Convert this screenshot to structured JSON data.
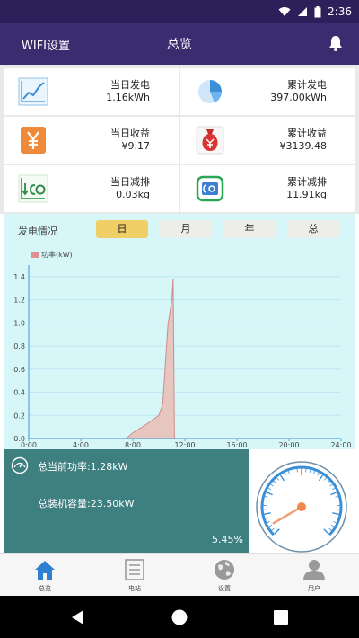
{
  "status_bar": {
    "time": "2:36"
  },
  "app_bar": {
    "left_label": "WIFI设置",
    "title": "总览",
    "bell_icon": "bell-icon"
  },
  "stats": [
    {
      "icon": "line-chart-icon",
      "label": "当日发电",
      "value": "1.16kWh"
    },
    {
      "icon": "pie-chart-icon",
      "label": "累计发电",
      "value": "397.00kWh"
    },
    {
      "icon": "yuan-icon",
      "label": "当日收益",
      "value": "¥9.17"
    },
    {
      "icon": "money-bag-icon",
      "label": "累计收益",
      "value": "¥3139.48"
    },
    {
      "icon": "co2-down-icon",
      "label": "当日减排",
      "value": "0.03kg"
    },
    {
      "icon": "co2-cycle-icon",
      "label": "累计减排",
      "value": "11.91kg"
    }
  ],
  "generation": {
    "label": "发电情况",
    "tabs": [
      "日",
      "月",
      "年",
      "总"
    ],
    "active_tab": 0
  },
  "chart_data": {
    "type": "area",
    "legend": "功率(kW)",
    "x": [
      0,
      7.5,
      8,
      9,
      10,
      10.3,
      10.5,
      10.7,
      11,
      11.1,
      11.2,
      24
    ],
    "y": [
      0,
      0,
      0.05,
      0.12,
      0.2,
      0.3,
      0.65,
      0.98,
      1.2,
      1.38,
      0,
      0
    ],
    "x_ticks": [
      "0:00",
      "4:00",
      "8:00",
      "12:00",
      "16:00",
      "20:00",
      "24:00"
    ],
    "y_ticks": [
      "0.0",
      "0.2",
      "0.4",
      "0.6",
      "0.8",
      "1.0",
      "1.2",
      "1.4"
    ],
    "xlim": [
      0,
      24
    ],
    "ylim": [
      0,
      1.5
    ],
    "grid": true,
    "colors": {
      "fill": "#e7c6c0",
      "line": "#d08a8a",
      "axis": "#5aa6e0",
      "grid": "#bfe6f2"
    }
  },
  "power": {
    "current": "总当前功率:1.28kW",
    "capacity": "总装机容量:23.50kW",
    "percent": "5.45%",
    "gauge_fraction": 0.0545
  },
  "bottom_nav": [
    {
      "icon": "home-icon",
      "label": "总览",
      "active": true
    },
    {
      "icon": "list-icon",
      "label": "电站",
      "active": false
    },
    {
      "icon": "globe-icon",
      "label": "设置",
      "active": false
    },
    {
      "icon": "user-icon",
      "label": "用户",
      "active": false
    }
  ],
  "colors": {
    "primary": "#3a2c6e",
    "panel": "#3e7f80",
    "chart_bg": "#d6f6f8",
    "tab_active": "#f0cf66"
  }
}
